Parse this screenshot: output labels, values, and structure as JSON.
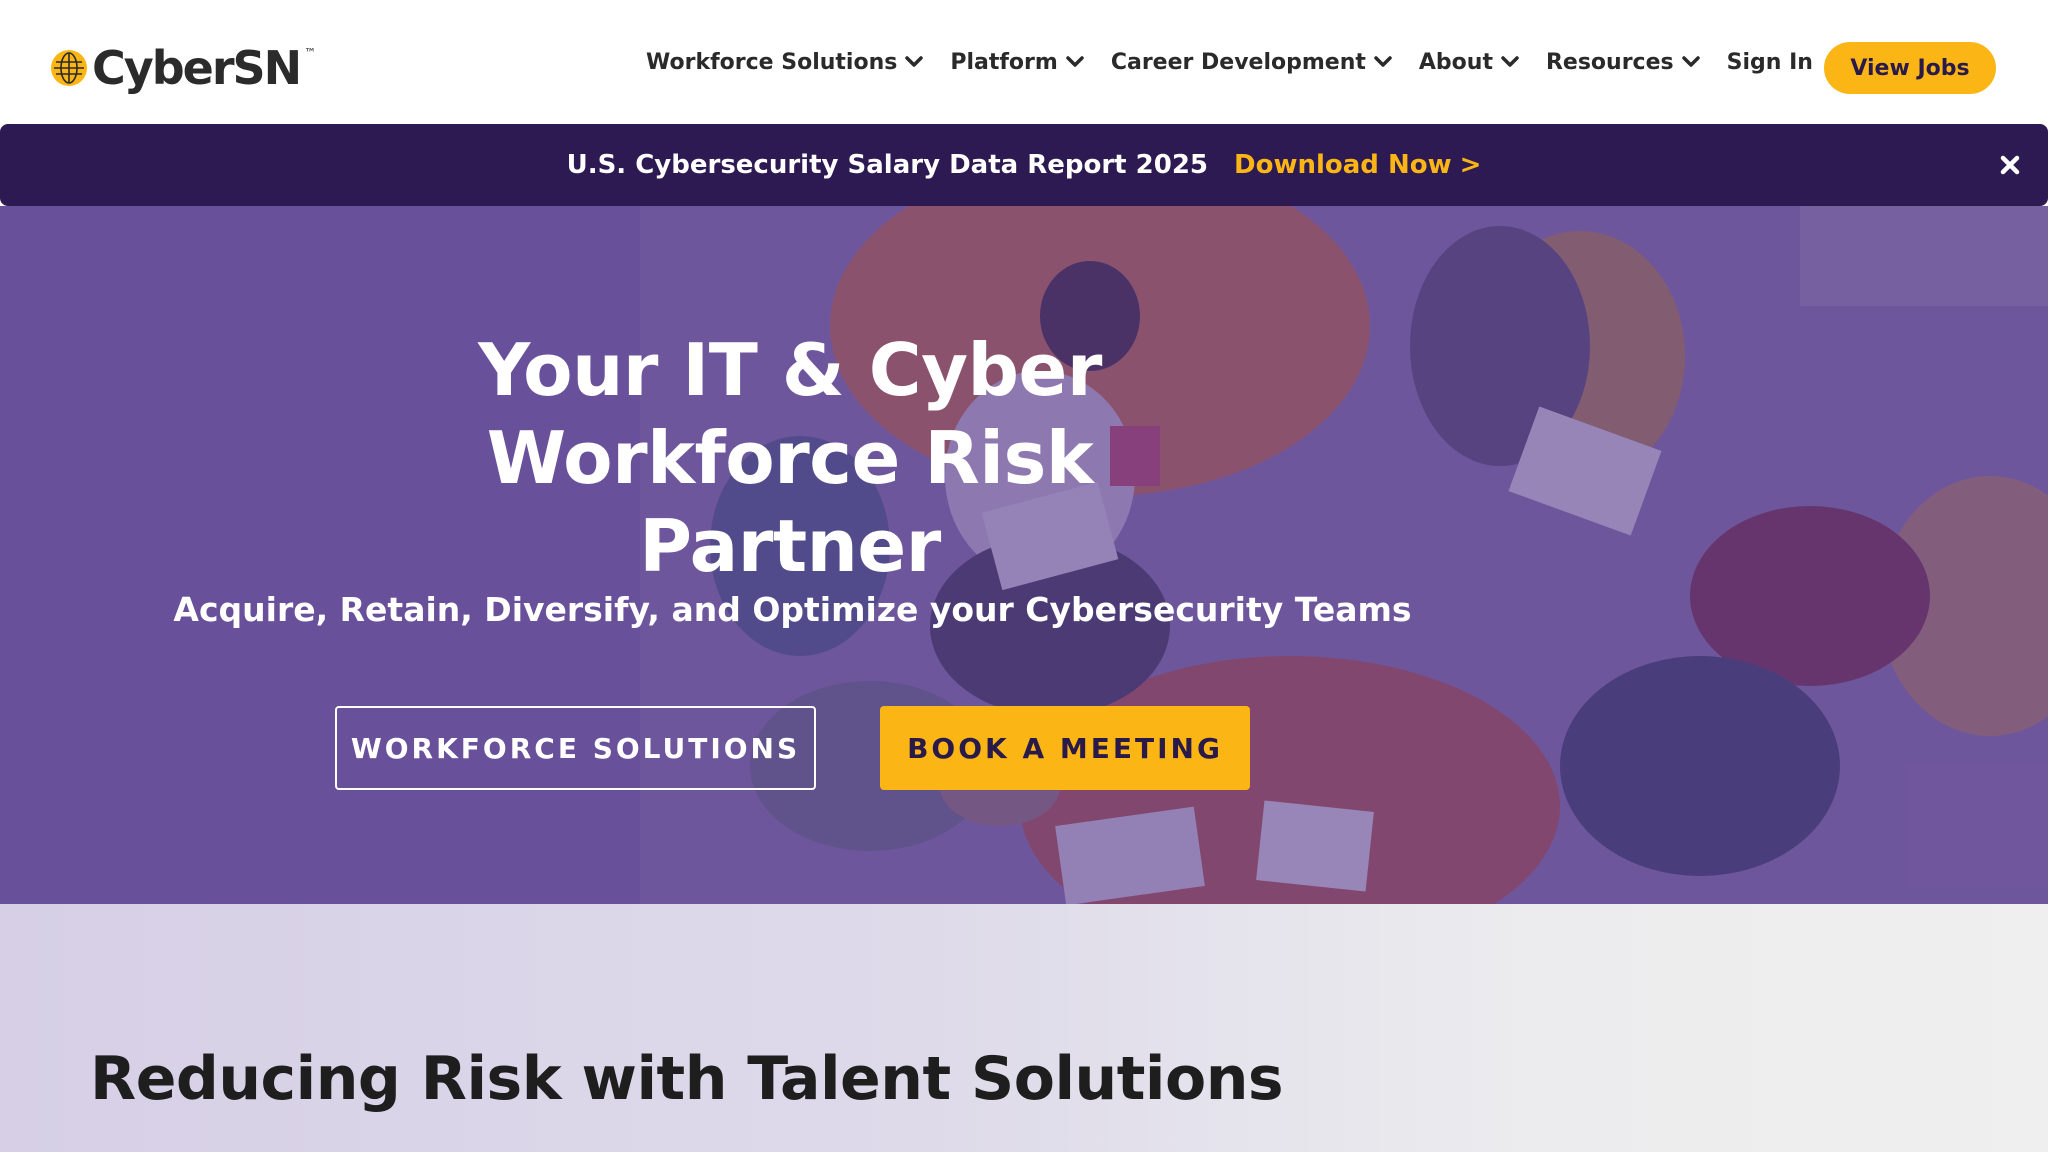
{
  "header": {
    "logo_text": "CyberSN",
    "logo_tm": "™",
    "nav": [
      {
        "label": "Workforce Solutions",
        "has_dropdown": true
      },
      {
        "label": "Platform",
        "has_dropdown": true
      },
      {
        "label": "Career Development",
        "has_dropdown": true
      },
      {
        "label": "About",
        "has_dropdown": true
      },
      {
        "label": "Resources",
        "has_dropdown": true
      }
    ],
    "sign_in_label": "Sign In",
    "view_jobs_label": "View Jobs"
  },
  "announcement": {
    "text": "U.S. Cybersecurity Salary Data Report 2025",
    "link_label": "Download Now",
    "link_arrow": ">",
    "close_icon": "close-icon"
  },
  "hero": {
    "title_lines": [
      "Your IT & Cyber",
      "Workforce Risk",
      "Partner"
    ],
    "subtitle": "Acquire, Retain, Diversify, and Optimize your Cybersecurity Teams",
    "primary_button": "WORKFORCE SOLUTIONS",
    "secondary_button": "BOOK A MEETING"
  },
  "section": {
    "title": "Reducing Risk with Talent Solutions"
  },
  "colors": {
    "accent_yellow": "#fbb615",
    "banner_purple": "#2d1a52",
    "hero_overlay": "#583a8c",
    "text_dark": "#1e1e1e"
  }
}
